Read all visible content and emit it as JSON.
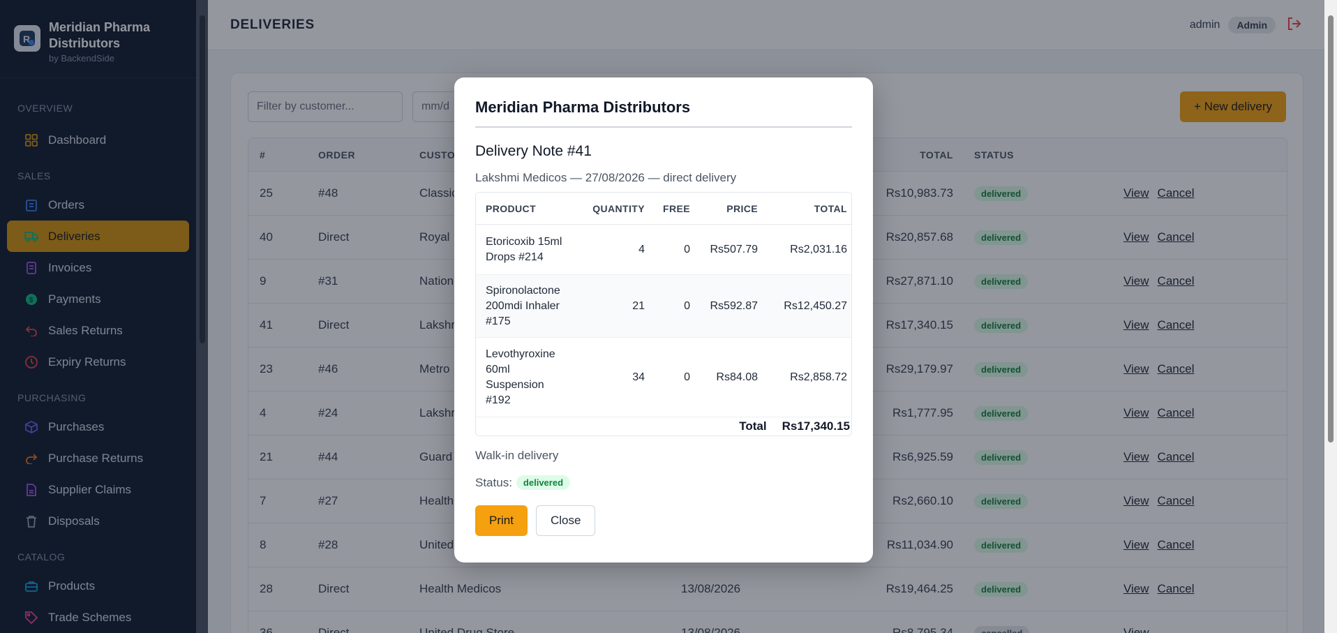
{
  "brand": {
    "name_line1": "Meridian Pharma",
    "name_line2": "Distributors",
    "by": "by BackendSide"
  },
  "sidebar": {
    "sections": [
      {
        "label": "OVERVIEW",
        "items": [
          {
            "label": "Dashboard",
            "icon": "grid-icon"
          }
        ]
      },
      {
        "label": "SALES",
        "items": [
          {
            "label": "Orders",
            "icon": "clipboard-icon"
          },
          {
            "label": "Deliveries",
            "icon": "truck-icon",
            "active": true
          },
          {
            "label": "Invoices",
            "icon": "document-icon"
          },
          {
            "label": "Payments",
            "icon": "coin-icon"
          },
          {
            "label": "Sales Returns",
            "icon": "return-icon"
          },
          {
            "label": "Expiry Returns",
            "icon": "clock-icon"
          }
        ]
      },
      {
        "label": "PURCHASING",
        "items": [
          {
            "label": "Purchases",
            "icon": "box-icon"
          },
          {
            "label": "Purchase Returns",
            "icon": "redo-icon"
          },
          {
            "label": "Supplier Claims",
            "icon": "file-icon"
          },
          {
            "label": "Disposals",
            "icon": "trash-icon"
          }
        ]
      },
      {
        "label": "CATALOG",
        "items": [
          {
            "label": "Products",
            "icon": "briefcase-icon"
          },
          {
            "label": "Trade Schemes",
            "icon": "tag-icon"
          }
        ]
      }
    ]
  },
  "header": {
    "title": "DELIVERIES",
    "user": "admin",
    "role": "Admin"
  },
  "filters": {
    "customer_placeholder": "Filter by customer...",
    "date_placeholder": "mm/d"
  },
  "new_button": "+ New delivery",
  "table": {
    "columns": {
      "num": "#",
      "order": "ORDER",
      "customer": "CUSTO",
      "total": "TOTAL",
      "status": "STATUS"
    },
    "rows": [
      {
        "num": "25",
        "order": "#48",
        "customer": "Classic",
        "date": "",
        "total": "Rs10,983.73",
        "status": "delivered",
        "view": "View",
        "cancel": "Cancel"
      },
      {
        "num": "40",
        "order": "Direct",
        "customer": "Royal",
        "date": "",
        "total": "Rs20,857.68",
        "status": "delivered",
        "view": "View",
        "cancel": "Cancel"
      },
      {
        "num": "9",
        "order": "#31",
        "customer": "Nation",
        "date": "",
        "total": "Rs27,871.10",
        "status": "delivered",
        "view": "View",
        "cancel": "Cancel"
      },
      {
        "num": "41",
        "order": "Direct",
        "customer": "Lakshr",
        "date": "",
        "total": "Rs17,340.15",
        "status": "delivered",
        "view": "View",
        "cancel": "Cancel"
      },
      {
        "num": "23",
        "order": "#46",
        "customer": "Metro",
        "date": "",
        "total": "Rs29,179.97",
        "status": "delivered",
        "view": "View",
        "cancel": "Cancel"
      },
      {
        "num": "4",
        "order": "#24",
        "customer": "Lakshr",
        "date": "",
        "total": "Rs1,777.95",
        "status": "delivered",
        "view": "View",
        "cancel": "Cancel"
      },
      {
        "num": "21",
        "order": "#44",
        "customer": "Guard",
        "date": "",
        "total": "Rs6,925.59",
        "status": "delivered",
        "view": "View",
        "cancel": "Cancel"
      },
      {
        "num": "7",
        "order": "#27",
        "customer": "Health",
        "date": "",
        "total": "Rs2,660.10",
        "status": "delivered",
        "view": "View",
        "cancel": "Cancel"
      },
      {
        "num": "8",
        "order": "#28",
        "customer": "United",
        "date": "",
        "total": "Rs11,034.90",
        "status": "delivered",
        "view": "View",
        "cancel": "Cancel"
      },
      {
        "num": "28",
        "order": "Direct",
        "customer": "Health Medicos",
        "date": "13/08/2026",
        "total": "Rs19,464.25",
        "status": "delivered",
        "view": "View",
        "cancel": "Cancel"
      },
      {
        "num": "36",
        "order": "Direct",
        "customer": "United Drug Store",
        "date": "13/08/2026",
        "total": "Rs8,795.34",
        "status": "cancelled",
        "view": "View",
        "cancel": ""
      }
    ]
  },
  "modal": {
    "company": "Meridian Pharma Distributors",
    "title": "Delivery Note #41",
    "subtitle": "Lakshmi Medicos — 27/08/2026 — direct delivery",
    "columns": {
      "product": "PRODUCT",
      "quantity": "QUANTITY",
      "free": "FREE",
      "price": "PRICE",
      "total": "TOTAL"
    },
    "lines": [
      {
        "product": "Etoricoxib 15ml Drops #214",
        "quantity": "4",
        "free": "0",
        "price": "Rs507.79",
        "total": "Rs2,031.16"
      },
      {
        "product": "Spironolactone 200mdi Inhaler #175",
        "quantity": "21",
        "free": "0",
        "price": "Rs592.87",
        "total": "Rs12,450.27"
      },
      {
        "product": "Levothyroxine 60ml Suspension #192",
        "quantity": "34",
        "free": "0",
        "price": "Rs84.08",
        "total": "Rs2,858.72"
      }
    ],
    "total_label": "Total",
    "total_value": "Rs17,340.15",
    "note": "Walk-in delivery",
    "status_label": "Status:",
    "status": "delivered",
    "print_label": "Print",
    "close_label": "Close"
  },
  "colors": {
    "sidebar_bg": "#111c2e",
    "accent": "#f5a00f",
    "active_nav": "#d4940c",
    "delivered_bg": "#dcfce7",
    "delivered_text": "#15803d"
  }
}
